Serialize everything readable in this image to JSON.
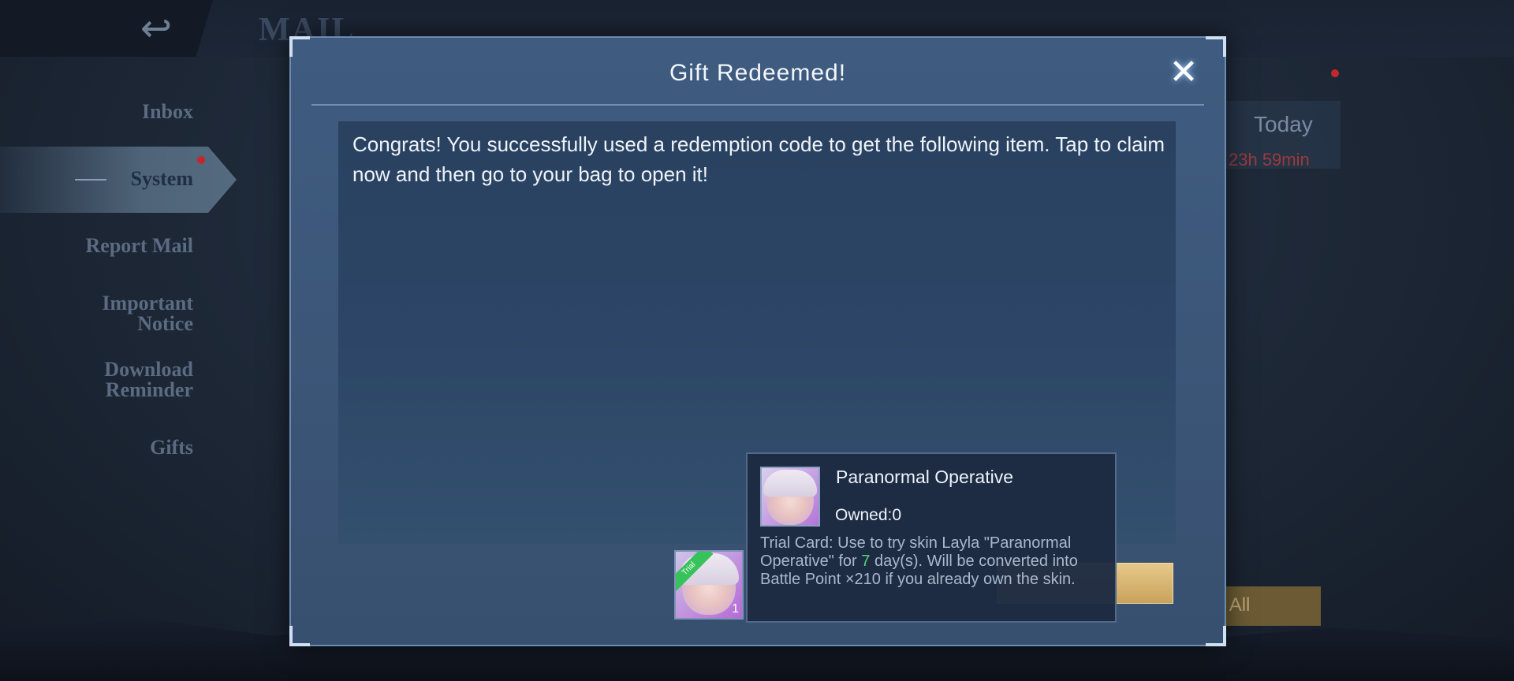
{
  "background": {
    "mail_title": "MAIL",
    "back_icon": "back-arrow-icon",
    "sidebar": {
      "items": [
        {
          "label": "Inbox"
        },
        {
          "label": "System",
          "active": true,
          "has_notification": true
        },
        {
          "label": "Report Mail"
        },
        {
          "label": "Important Notice"
        },
        {
          "label": "Download Reminder"
        },
        {
          "label": "Gifts"
        }
      ]
    },
    "mail_item": {
      "date": "Today",
      "timer": "23h 59min"
    },
    "claim_all_label": "n All"
  },
  "dialog": {
    "title": "Gift Redeemed!",
    "close_icon": "close-x-icon",
    "message": "Congrats! You successfully used a redemption code to get the following item. Tap to claim now and then go to your bag to open it!",
    "reward": {
      "quantity": "1",
      "ribbon": "Trial"
    }
  },
  "tooltip": {
    "name": "Paranormal Operative",
    "owned": "Owned:0",
    "desc_part1": "Trial Card: Use to try skin Layla \"Paranormal Operative\" for ",
    "desc_days": "7",
    "desc_part2": " day(s). Will be converted into Battle Point ×210 if you already own the skin."
  },
  "colors": {
    "accent_gold": "#c9a35c",
    "highlight_green": "#56d27a",
    "notification_red": "#c0282d"
  }
}
